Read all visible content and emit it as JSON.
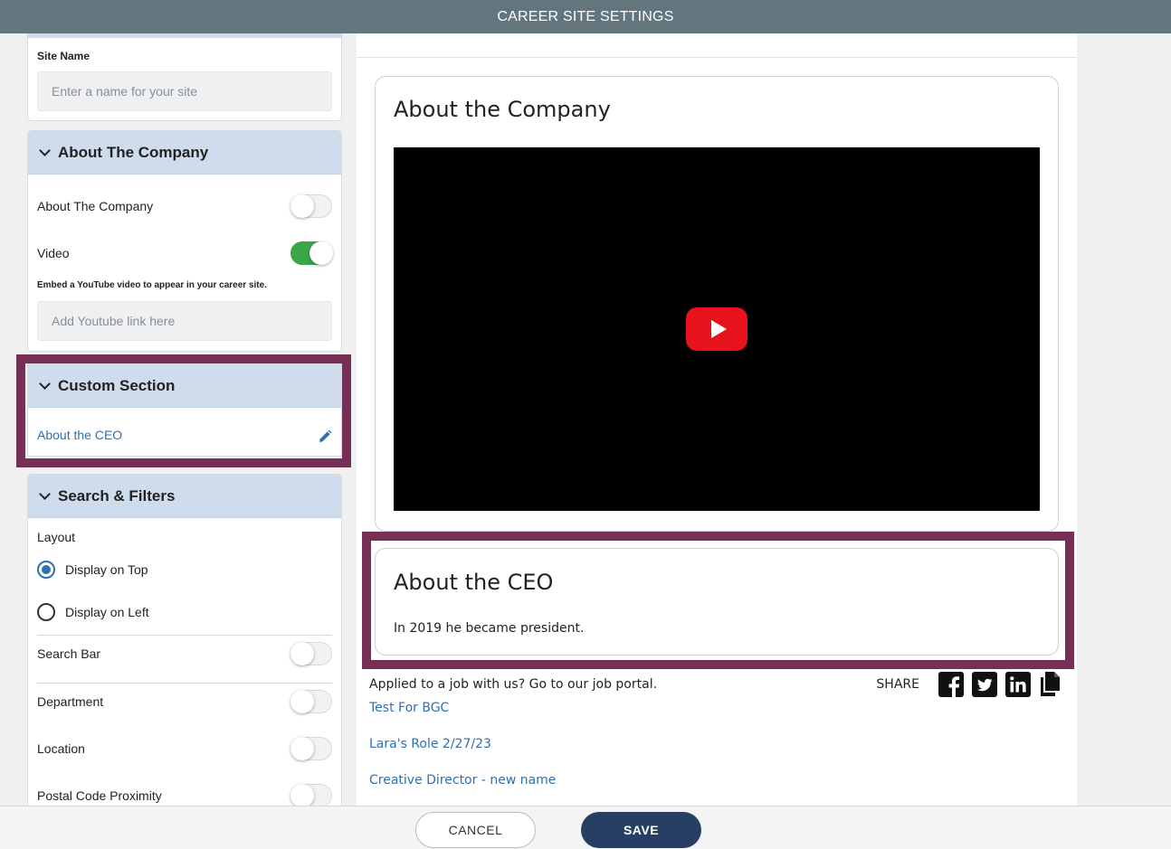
{
  "header": {
    "title": "CAREER SITE SETTINGS"
  },
  "settings": {
    "site_name": {
      "label": "Site Name",
      "placeholder": "Enter a name for your site"
    },
    "about_company": {
      "heading": "About The Company",
      "toggles": [
        {
          "label": "About The Company",
          "on": false
        },
        {
          "label": "Video",
          "on": true
        }
      ],
      "video_hint": "Embed a YouTube video to appear in your career site.",
      "video_placeholder": "Add Youtube link here"
    },
    "custom_section": {
      "heading": "Custom Section",
      "item": "About the CEO",
      "highlight_color": "#762f55"
    },
    "search_filters": {
      "heading": "Search & Filters",
      "layout_label": "Layout",
      "layout_options": [
        {
          "label": "Display on Top",
          "selected": true
        },
        {
          "label": "Display on Left",
          "selected": false
        }
      ],
      "toggles": [
        {
          "label": "Search Bar",
          "on": false
        },
        {
          "label": "Department",
          "on": false
        },
        {
          "label": "Location",
          "on": false
        },
        {
          "label": "Postal Code Proximity",
          "on": false
        }
      ]
    }
  },
  "preview": {
    "about_company_title": "About the Company",
    "ceo_title": "About the CEO",
    "ceo_text": "In 2019 he became president.",
    "portal_text": "Applied to a job with us? Go to our job portal.",
    "share_label": "SHARE",
    "job_links": [
      "Test For BGC",
      "Lara's Role 2/27/23",
      "Creative Director - new name"
    ]
  },
  "footer": {
    "cancel_label": "CANCEL",
    "save_label": "SAVE"
  },
  "colors": {
    "accent": "#263f63",
    "topbar": "#63767e",
    "toggle_on": "#3aa648",
    "youtube": "#e8121c",
    "link": "#2f6fb3"
  }
}
